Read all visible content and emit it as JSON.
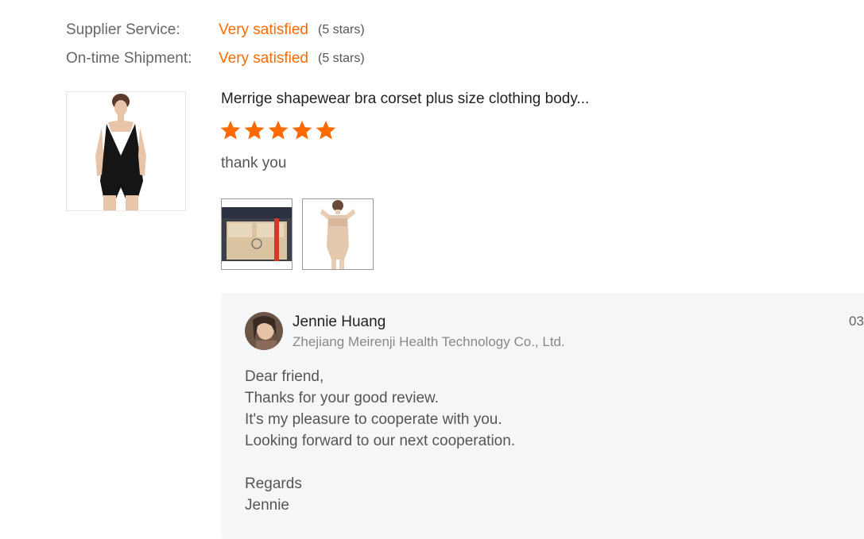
{
  "ratings": [
    {
      "label": "Supplier Service:",
      "value": "Very satisfied",
      "stars": "(5 stars)"
    },
    {
      "label": "On-time Shipment:",
      "value": "Very satisfied",
      "stars": "(5 stars)"
    }
  ],
  "review": {
    "product_title": "Merrige shapewear bra corset plus size clothing body...",
    "rating": 5,
    "max_rating": 5,
    "text": "thank you"
  },
  "reply": {
    "name": "Jennie Huang",
    "company": "Zhejiang Meirenji Health Technology Co., Ltd.",
    "date": "03",
    "lines": [
      "Dear friend,",
      "Thanks for your good review.",
      "It's my pleasure to cooperate with you.",
      "Looking forward to our next cooperation.",
      "",
      "Regards",
      "Jennie"
    ]
  },
  "colors": {
    "accent": "#ff6a00",
    "reply_bg": "#f5f6f8"
  }
}
